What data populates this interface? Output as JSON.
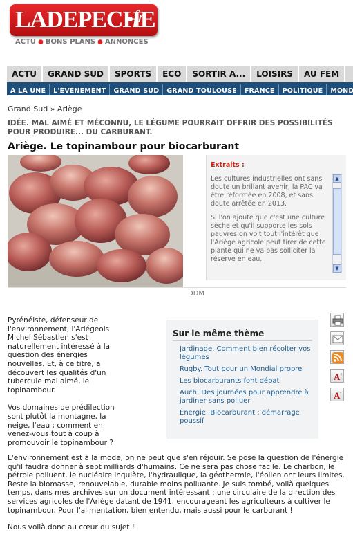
{
  "logo": {
    "main": "LADEPECHE",
    "suffix": "fr"
  },
  "top_links": [
    "ACTU",
    "BONS PLANS",
    "ANNONCES"
  ],
  "nav_primary": [
    "ACTU",
    "GRAND SUD",
    "SPORTS",
    "ECO",
    "SORTIR A...",
    "LOISIRS",
    "AU FEM"
  ],
  "nav_secondary": [
    "A LA UNE",
    "L'ÉVÈNEMENT",
    "GRAND SUD",
    "GRAND TOULOUSE",
    "FRANCE",
    "POLITIQUE",
    "MONDE"
  ],
  "breadcrumb": {
    "parent": "Grand Sud",
    "separator": "»",
    "current": "Ariège"
  },
  "article": {
    "kicker": "IDÉE. MAL AIMÉ ET MÉCONNU, LE LÉGUME POURRAIT OFFRIR DES POSSIBILITÉS POUR PRODUIRE... DU CARBURANT.",
    "headline": "Ariège. Le topinambour pour biocarburant",
    "photo_caption": "DDM",
    "extract_label": "Extraits :",
    "extract_paragraphs": [
      "Les cultures industrielles ont sans doute un brillant avenir, la PAC va être réformée en 2008, et sans doute arrêtée en 2013.",
      "Si l'on ajoute que c'est une culture sèche et qu'il supporte les sols pauvres on voit tout l'intérêt que l'Ariège agricole peut tirer de cette plante qui ne va pas solliciter la réserve en eau."
    ],
    "intro_paragraphs": [
      "Pyrénéiste, défenseur de l'environnement, l'Ariégeois Michel Sébastien s'est naturellement intéressé à la question des énergies nouvelles. Et, à ce titre, a découvert les qualités d'un tubercule mal aimé, le topinambour.",
      "Vos domaines de prédilection sont plutôt la montagne, la neige, l'eau ; comment en venez-vous tout à coup à promouvoir le topinambour ?"
    ],
    "body_paragraphs": [
      "L'environnement est à la mode, on ne peut que s'en réjouir. Se pose la question de l'énergie qu'il faudra donner à sept milliards d'humains. Ce ne sera pas chose facile. Le charbon, le pétrole polluent, le nucléaire inquiète, l'hydraulique, la géothermie, l'éolien ont leurs limites. Reste la biomasse, renouvelable, durable moins polluante. Je suis tombé, voilà quelques temps, dans mes archives sur un document intéressant : une circulaire de la direction des services agricoles de l'Ariège datant de 1941, encourageant les agriculteurs à cultiver le topinambour. Pour l'alimentation, bien entendu, mais aussi pour le carburant !",
      "Nous voilà donc au cœur du sujet !"
    ]
  },
  "related": {
    "title": "Sur le même thème",
    "links": [
      "Jardinage. Comment bien récolter vos légumes",
      "Rugby. Tout pour un Mondial propre",
      "Les biocarburants font débat",
      "Auch. Des journées pour apprendre à jardiner sans polluer",
      "Énergie. Biocarburant : démarrage poussif"
    ]
  },
  "tools": [
    "print-icon",
    "email-icon",
    "rss-icon",
    "font-increase-icon",
    "font-decrease-icon"
  ],
  "colors": {
    "brand_red": "#d0191c",
    "nav_blue": "#1e4f7a",
    "link_blue": "#1f5f91",
    "extract_red": "#cc2211"
  }
}
